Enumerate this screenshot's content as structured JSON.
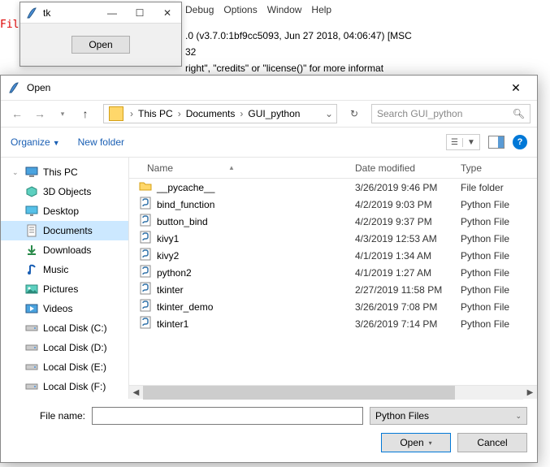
{
  "bg_menu": {
    "debug": "Debug",
    "options": "Options",
    "window": "Window",
    "help": "Help"
  },
  "bg_line1": ".0 (v3.7.0:1bf9cc5093, Jun 27 2018, 04:06:47) [MSC",
  "bg_line2": "32",
  "bg_line3": "right\", \"credits\" or \"license()\" for more informat",
  "bg_red": "File\n##\n##\nfro\nfro",
  "tk": {
    "title": "tk",
    "open": "Open"
  },
  "dialog": {
    "title": "Open",
    "crumbs": {
      "pc": "This PC",
      "docs": "Documents",
      "folder": "GUI_python"
    },
    "search_placeholder": "Search GUI_python",
    "organize": "Organize",
    "newfolder": "New folder",
    "columns": {
      "name": "Name",
      "date": "Date modified",
      "type": "Type"
    },
    "fn_label": "File name:",
    "fn_value": "",
    "filter": "Python Files",
    "open_btn": "Open",
    "cancel_btn": "Cancel"
  },
  "tree": [
    {
      "label": "This PC",
      "icon": "pc",
      "caret": true
    },
    {
      "label": "3D Objects",
      "icon": "3d"
    },
    {
      "label": "Desktop",
      "icon": "desktop"
    },
    {
      "label": "Documents",
      "icon": "docs",
      "selected": true
    },
    {
      "label": "Downloads",
      "icon": "downloads"
    },
    {
      "label": "Music",
      "icon": "music"
    },
    {
      "label": "Pictures",
      "icon": "pictures"
    },
    {
      "label": "Videos",
      "icon": "videos"
    },
    {
      "label": "Local Disk (C:)",
      "icon": "drive"
    },
    {
      "label": "Local Disk (D:)",
      "icon": "drive"
    },
    {
      "label": "Local Disk (E:)",
      "icon": "drive"
    },
    {
      "label": "Local Disk (F:)",
      "icon": "drive"
    }
  ],
  "files": [
    {
      "name": "__pycache__",
      "date": "3/26/2019 9:46 PM",
      "type": "File folder",
      "icon": "folder"
    },
    {
      "name": "bind_function",
      "date": "4/2/2019 9:03 PM",
      "type": "Python File",
      "icon": "py"
    },
    {
      "name": "button_bind",
      "date": "4/2/2019 9:37 PM",
      "type": "Python File",
      "icon": "py"
    },
    {
      "name": "kivy1",
      "date": "4/3/2019 12:53 AM",
      "type": "Python File",
      "icon": "py"
    },
    {
      "name": "kivy2",
      "date": "4/1/2019 1:34 AM",
      "type": "Python File",
      "icon": "py"
    },
    {
      "name": "python2",
      "date": "4/1/2019 1:27 AM",
      "type": "Python File",
      "icon": "py"
    },
    {
      "name": "tkinter",
      "date": "2/27/2019 11:58 PM",
      "type": "Python File",
      "icon": "py"
    },
    {
      "name": "tkinter_demo",
      "date": "3/26/2019 7:08 PM",
      "type": "Python File",
      "icon": "py"
    },
    {
      "name": "tkinter1",
      "date": "3/26/2019 7:14 PM",
      "type": "Python File",
      "icon": "py"
    }
  ]
}
